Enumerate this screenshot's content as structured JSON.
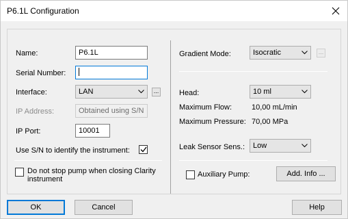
{
  "window": {
    "title": "P6.1L Configuration"
  },
  "left": {
    "name_label": "Name:",
    "name_value": "P6.1L",
    "serial_label": "Serial Number:",
    "serial_value": "",
    "interface_label": "Interface:",
    "interface_value": "LAN",
    "ip_address_label": "IP Address:",
    "ip_address_value": "Obtained using S/N",
    "ip_port_label": "IP Port:",
    "ip_port_value": "10001",
    "use_sn_label": "Use S/N to identify the instrument:",
    "use_sn_checked": true,
    "do_not_stop_label_line1": "Do not stop pump when closing Clarity",
    "do_not_stop_label_line2": "instrument",
    "do_not_stop_checked": false
  },
  "right": {
    "gradient_label": "Gradient Mode:",
    "gradient_value": "Isocratic",
    "head_label": "Head:",
    "head_value": "10 ml",
    "max_flow_label": "Maximum Flow:",
    "max_flow_value": "10,00 mL/min",
    "max_pressure_label": "Maximum Pressure:",
    "max_pressure_value": "70,00 MPa",
    "leak_label": "Leak Sensor Sens.:",
    "leak_value": "Low",
    "aux_pump_label": "Auxiliary Pump:",
    "aux_pump_checked": false,
    "add_info_label": "Add. Info ..."
  },
  "ellipsis": "...",
  "buttons": {
    "ok": "OK",
    "cancel": "Cancel",
    "help": "Help"
  }
}
